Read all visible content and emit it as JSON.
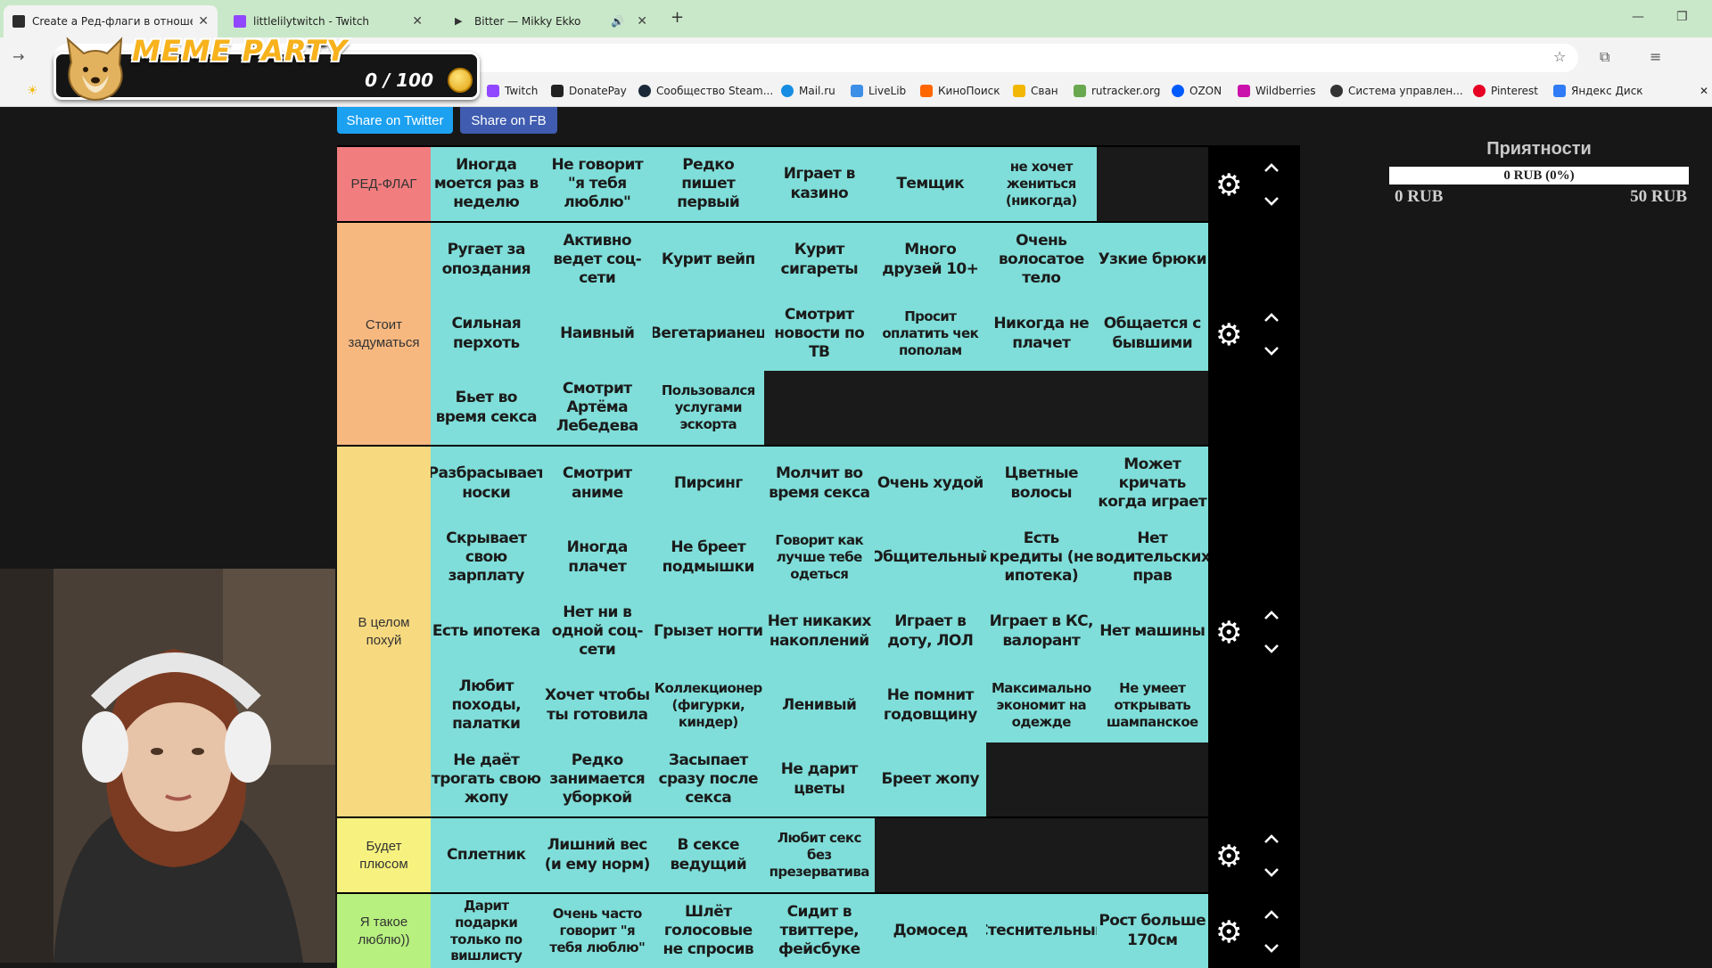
{
  "browser": {
    "tabs": [
      {
        "title": "Create a Ред-флаги в отношен",
        "active": true,
        "color": "#2d2d2d"
      },
      {
        "title": "littlelilytwitch - Twitch",
        "active": false,
        "color": "#9146ff"
      },
      {
        "title": "Bitter — Mikky Ekko",
        "active": false,
        "color": "#555555"
      }
    ],
    "new_tab_symbol": "+",
    "bookmarks": [
      {
        "label": "Twitch",
        "color": "#9146ff"
      },
      {
        "label": "DonatePay",
        "color": "#222222"
      },
      {
        "label": "Сообщество Steam...",
        "color": "#1b2838"
      },
      {
        "label": "Mail.ru",
        "color": "#168de2"
      },
      {
        "label": "LiveLib",
        "color": "#3d8ee6"
      },
      {
        "label": "КиноПоиск",
        "color": "#ff6600"
      },
      {
        "label": "Сван",
        "color": "#f2b705"
      },
      {
        "label": "rutracker.org",
        "color": "#6aa84f"
      },
      {
        "label": "OZON",
        "color": "#005bff"
      },
      {
        "label": "Wildberries",
        "color": "#cb11ab"
      },
      {
        "label": "Система управлен...",
        "color": "#333333"
      },
      {
        "label": "Pinterest",
        "color": "#e60023"
      },
      {
        "label": "Яндекс Диск",
        "color": "#2f7cf6"
      }
    ]
  },
  "overlay": {
    "title": "MEME PARTY",
    "score": "0 / 100"
  },
  "share": {
    "twitter_label": "Share on Twitter",
    "fb_label": "Share on FB"
  },
  "tiers": [
    {
      "label": "РЕД-ФЛАГ",
      "color": "#f17d7f",
      "items": [
        "Иногда моется раз в неделю",
        "Не говорит \"я тебя люблю\"",
        "Редко пишет первый",
        "Играет в казино",
        "Темщик",
        "не хочет жениться (никогда)"
      ]
    },
    {
      "label": "Стоит задуматься",
      "color": "#f7b880",
      "items": [
        "Ругает за опоздания",
        "Активно ведет соц-сети",
        "Курит вейп",
        "Курит сигареты",
        "Много друзей 10+",
        "Очень волосатое тело",
        "Узкие брюки",
        "Сильная перхоть",
        "Наивный",
        "Вегетарианец",
        "Смотрит новости по ТВ",
        "Просит оплатить чек пополам",
        "Никогда не плачет",
        "Общается с бывшими",
        "Бьет во время секса",
        "Смотрит Артёма Лебедева",
        "Пользовался услугами эскорта"
      ]
    },
    {
      "label": "В целом похуй",
      "color": "#f7d97f",
      "items": [
        "Разбрасывает носки",
        "Смотрит аниме",
        "Пирсинг",
        "Молчит во время секса",
        "Очень худой",
        "Цветные волосы",
        "Может кричать когда играет",
        "Скрывает свою зарплату",
        "Иногда плачет",
        "Не бреет подмышки",
        "Говорит как лучше тебе одеться",
        "Общительный",
        "Есть кредиты (не ипотека)",
        "Нет водительских прав",
        "Есть ипотека",
        "Нет ни в одной соц-сети",
        "Грызет ногти",
        "Нет никаких накоплений",
        "Играет в доту, ЛОЛ",
        "Играет в КС, валорант",
        "Нет машины",
        "Любит походы, палатки",
        "Хочет чтобы ты готовила",
        "Коллекционер (фигурки, киндер)",
        "Ленивый",
        "Не помнит годовщину",
        "Максимально экономит на одежде",
        "Не умеет открывать шампанское",
        "Не даёт трогать свою жопу",
        "Редко занимается уборкой",
        "Засыпает сразу после секса",
        "Не дарит цветы",
        "Бреет жопу"
      ]
    },
    {
      "label": "Будет плюсом",
      "color": "#f7f27f",
      "items": [
        "Сплетник",
        "Лишний вес (и ему норм)",
        "В сексе ведущий",
        "Любит секс без презерватива"
      ]
    },
    {
      "label": "Я такое люблю))",
      "color": "#b7f07f",
      "items": [
        "Дарит подарки только по вишлисту",
        "Очень часто говорит \"я тебя люблю\"",
        "Шлёт голосовые не спросив",
        "Сидит в твиттере, фейсбуке",
        "Домосед",
        "Стеснительный",
        "Рост больше 170см"
      ]
    }
  ],
  "icons": {
    "gear": "gear-icon",
    "up": "chevron-up-icon",
    "down": "chevron-down-icon"
  },
  "donation": {
    "title": "Приятности",
    "progress_text": "0 RUB (0%)",
    "progress": 0,
    "min_label": "0 RUB",
    "max_label": "50 RUB"
  }
}
